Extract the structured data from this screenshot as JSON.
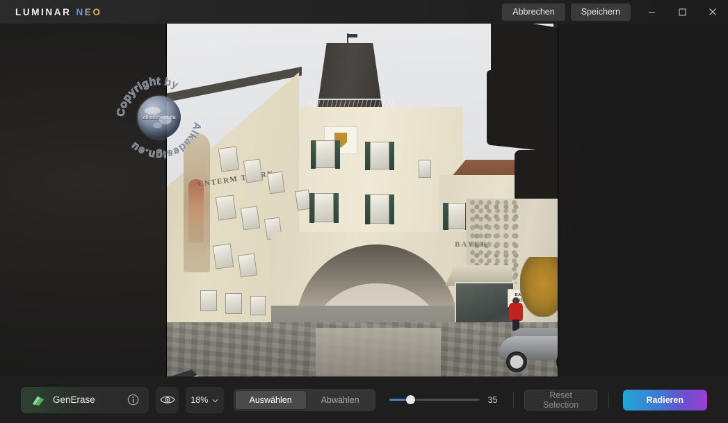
{
  "app": {
    "brand_primary": "LUMINAR",
    "brand_secondary": "NEO"
  },
  "titlebar": {
    "cancel_label": "Abbrechen",
    "save_label": "Speichern",
    "minimize_icon": "minimize-icon",
    "maximize_icon": "maximize-icon",
    "close_icon": "close-icon"
  },
  "canvas": {
    "watermark": {
      "top_text": "Copyright by",
      "bottom_text": "Alkadesign.eu",
      "globe_text": "alkadesign.eu",
      "bullet": "•"
    },
    "photo": {
      "building_sign_1": "UNTERM THURN",
      "building_sign_2": "RN",
      "shop_sign": "BAYER",
      "shop_plate": "BAYER MODE"
    }
  },
  "toolbar": {
    "tool_name": "GenErase",
    "tool_icon": "eraser-icon",
    "info_icon": "info-icon",
    "eye_icon": "eye-icon",
    "zoom_value": "18%",
    "zoom_chevron": "chevron-down-icon",
    "select_label": "Auswählen",
    "deselect_label": "Abwählen",
    "brush_size_value": "35",
    "brush_size_percent": 24,
    "reset_label": "Reset Selection",
    "erase_label": "Radieren",
    "accent_gradient_start": "#22a6d8",
    "accent_gradient_end": "#9b3fd0",
    "slider_fill_color": "#4a7fc1",
    "tool_accent_color": "#4caf50"
  }
}
